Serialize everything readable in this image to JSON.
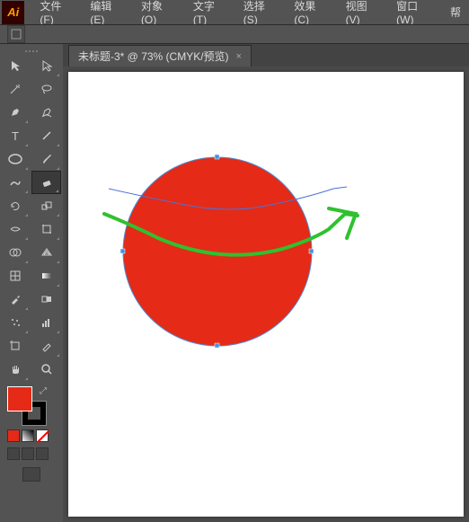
{
  "app": {
    "logo": "Ai"
  },
  "menu": {
    "file": "文件(F)",
    "edit": "编辑(E)",
    "object": "对象(O)",
    "type": "文字(T)",
    "select": "选择(S)",
    "effect": "效果(C)",
    "view": "视图(V)",
    "window": "窗口(W)",
    "help": "帮"
  },
  "tab": {
    "title": "未标题-3* @ 73% (CMYK/预览)",
    "close": "×"
  },
  "colors": {
    "fill": "#e52a17",
    "circle_fill": "#e52a17",
    "circle_stroke": "#4a90d9",
    "blue_line": "#4a72d9",
    "green_line": "#2ec22e"
  }
}
